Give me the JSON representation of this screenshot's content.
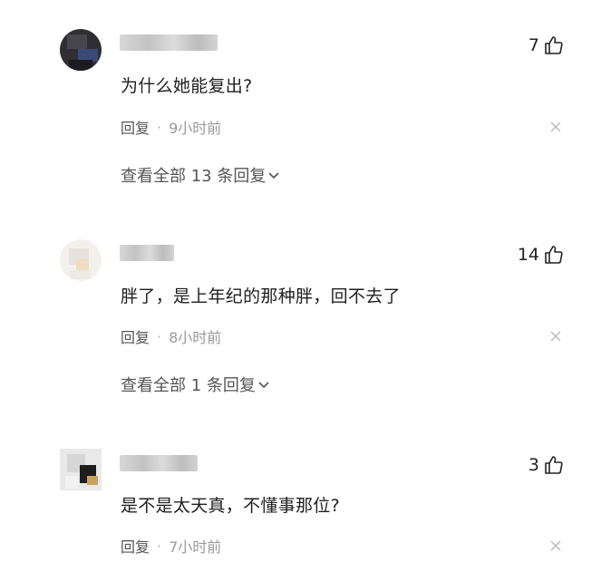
{
  "comments": [
    {
      "text": "为什么她能复出?",
      "likes": "7",
      "reply_label": "回复",
      "time": "9小时前",
      "more_replies": "查看全部 13 条回复"
    },
    {
      "text": "胖了，是上年纪的那种胖，回不去了",
      "likes": "14",
      "reply_label": "回复",
      "time": "8小时前",
      "more_replies": "查看全部 1 条回复"
    },
    {
      "text": "是不是太天真，不懂事那位?",
      "likes": "3",
      "reply_label": "回复",
      "time": "7小时前"
    }
  ],
  "icons": {
    "like": "thumbs-up-icon",
    "close": "close-icon",
    "expand": "chevron-down-icon"
  },
  "colors": {
    "text": "#1f1f1f",
    "meta": "#9a9a9a",
    "link": "#555555"
  }
}
